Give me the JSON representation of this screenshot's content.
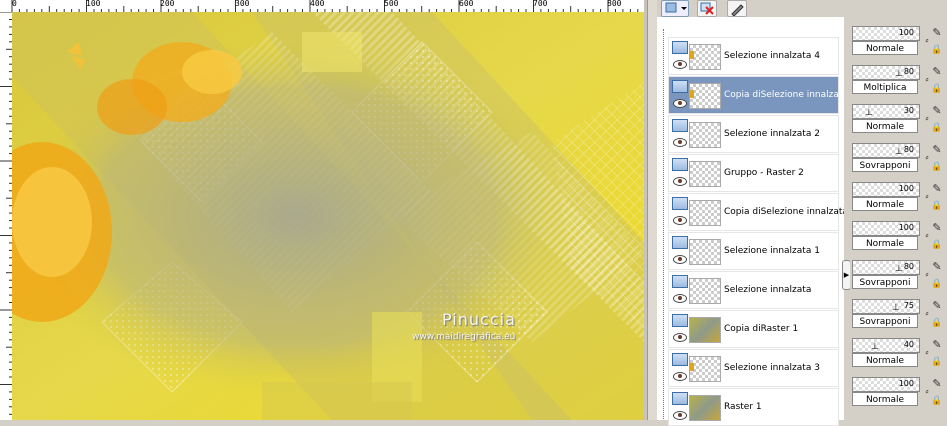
{
  "ruler": {
    "labels": [
      "0",
      "100",
      "200",
      "300",
      "400",
      "500",
      "600",
      "700",
      "800"
    ]
  },
  "canvas": {
    "watermark_title": "Pinuccia",
    "watermark_url": "www.maidiregrafica.eu"
  },
  "toolbar": {
    "icons": [
      "layer-visibility-icon",
      "delete-icon",
      "edit-icon"
    ]
  },
  "layers": [
    {
      "name": "Selezione innalzata 4",
      "selected": false,
      "thumb": "checker-mark"
    },
    {
      "name": "Copia diSelezione innalzata",
      "selected": true,
      "thumb": "checker-mark"
    },
    {
      "name": "Selezione innalzata 2",
      "selected": false,
      "thumb": "checker"
    },
    {
      "name": "Gruppo - Raster 2",
      "selected": false,
      "thumb": "checker"
    },
    {
      "name": "Copia diSelezione innalzata",
      "selected": false,
      "thumb": "checker"
    },
    {
      "name": "Selezione innalzata 1",
      "selected": false,
      "thumb": "checker"
    },
    {
      "name": "Selezione innalzata",
      "selected": false,
      "thumb": "checker"
    },
    {
      "name": "Copia diRaster 1",
      "selected": false,
      "thumb": "raster"
    },
    {
      "name": "Selezione innalzata 3",
      "selected": false,
      "thumb": "checker-mark"
    },
    {
      "name": "Raster 1",
      "selected": false,
      "thumb": "raster"
    }
  ],
  "properties": [
    {
      "opacity": "100",
      "blend": "Normale"
    },
    {
      "opacity": "80",
      "blend": "Moltiplica"
    },
    {
      "opacity": "30",
      "blend": "Normale"
    },
    {
      "opacity": "80",
      "blend": "Sovrapponi"
    },
    {
      "opacity": "100",
      "blend": "Normale"
    },
    {
      "opacity": "100",
      "blend": "Normale"
    },
    {
      "opacity": "80",
      "blend": "Sovrapponi"
    },
    {
      "opacity": "75",
      "blend": "Sovrapponi"
    },
    {
      "opacity": "40",
      "blend": "Normale"
    },
    {
      "opacity": "100",
      "blend": "Normale"
    }
  ],
  "colors": {
    "selection": "#7a96be",
    "canvas_yellow": "#e8d41c",
    "canvas_grey": "#b4b08a"
  }
}
